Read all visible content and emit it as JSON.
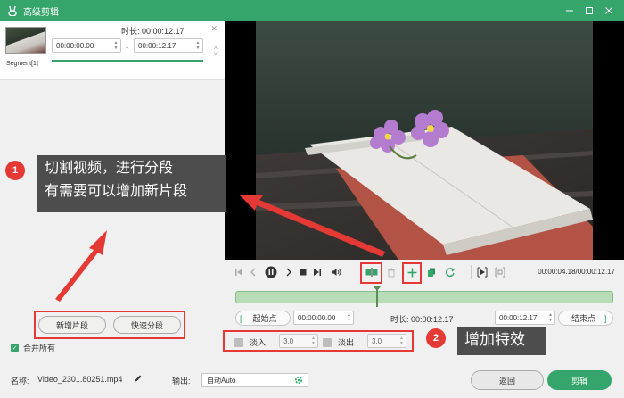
{
  "window": {
    "title": "高级剪辑",
    "icons": {
      "logo": "rabbit-logo-icon",
      "minimize": "minimize-icon",
      "maximize": "maximize-icon",
      "close": "close-icon"
    }
  },
  "segment": {
    "label": "Segment[1]",
    "duration": "时长: 00:00:12.17",
    "start": "00:00:00.00",
    "end": "00:00:12.17",
    "separator": "-"
  },
  "left_buttons": {
    "add_segment": "新增片段",
    "quick_split": "快速分段"
  },
  "merge_all": {
    "label": "合并所有",
    "checked": true
  },
  "player": {
    "time": "00:00:04.18/00:00:12.17",
    "icons": [
      "prev-frame-icon",
      "step-back-icon",
      "pause-icon",
      "step-forward-icon",
      "stop-icon",
      "next-frame-icon",
      "volume-icon",
      "split-icon",
      "delete-icon",
      "add-icon",
      "copy-icon",
      "reset-icon",
      "play-segment-icon",
      "crop-icon"
    ]
  },
  "range_row": {
    "start_label": "起始点",
    "start_value": "00:00:00.00",
    "duration_label": "时长: 00:00:12.17",
    "end_value": "00:00:12.17",
    "end_label": "结束点"
  },
  "fade": {
    "in_label": "淡入",
    "in_value": "3.0",
    "out_label": "淡出",
    "out_value": "3.0"
  },
  "annotations": {
    "badge1": "1",
    "callout1_line1": "切割视频，进行分段",
    "callout1_line2": "有需要可以增加新片段",
    "badge2": "2",
    "callout2": "增加特效"
  },
  "footer": {
    "name_label": "名称:",
    "file_name": "Video_230...80251.mp4",
    "output_label": "输出:",
    "output_value": "自动Auto",
    "back_button": "返回",
    "cut_button": "剪辑"
  },
  "colors": {
    "accent": "#35a56b",
    "annotation_red": "#e53935",
    "callout_bg": "#4d4d4d"
  }
}
